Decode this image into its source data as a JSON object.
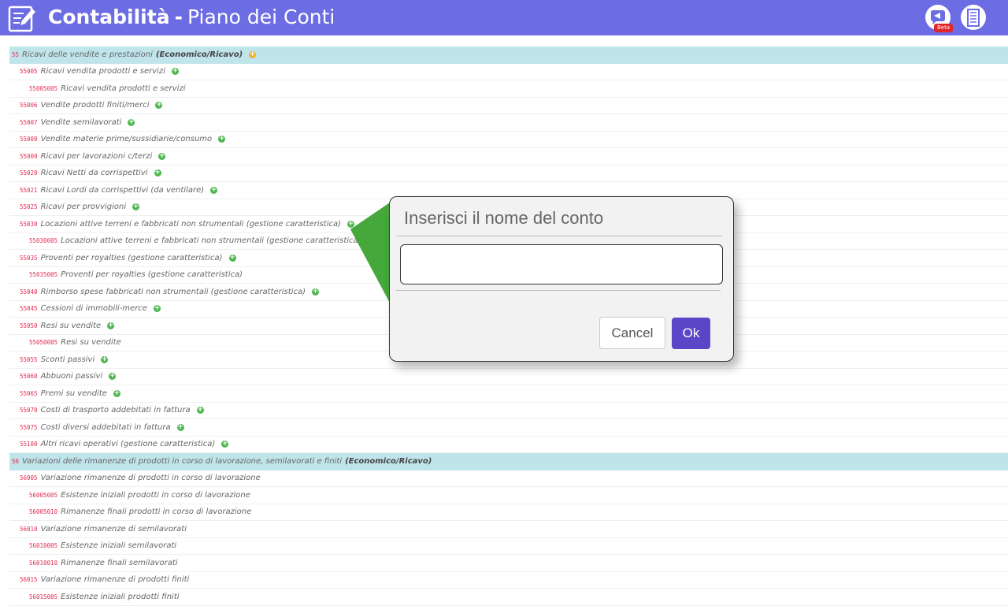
{
  "header": {
    "title": "Contabilità",
    "separator": "-",
    "subtitle": "Piano dei Conti",
    "beta_badge": "Beta"
  },
  "accounts": [
    {
      "level": 0,
      "code": "55",
      "name": "Ricavi delle vendite e prestazioni",
      "tag": "(Economico/Ricavo)",
      "add": true
    },
    {
      "level": 1,
      "code": "55005",
      "name": "Ricavi vendita prodotti e servizi",
      "add": true
    },
    {
      "level": 2,
      "code": "55005005",
      "name": "Ricavi vendita prodotti e servizi",
      "add": false
    },
    {
      "level": 1,
      "code": "55006",
      "name": "Vendite prodotti finiti/merci",
      "add": true
    },
    {
      "level": 1,
      "code": "55007",
      "name": "Vendite semilavorati",
      "add": true
    },
    {
      "level": 1,
      "code": "55008",
      "name": "Vendite materie prime/sussidiarie/consumo",
      "add": true
    },
    {
      "level": 1,
      "code": "55009",
      "name": "Ricavi per lavorazioni c/terzi",
      "add": true
    },
    {
      "level": 1,
      "code": "55020",
      "name": "Ricavi Netti da corrispettivi",
      "add": true
    },
    {
      "level": 1,
      "code": "55021",
      "name": "Ricavi Lordi da corrispettivi (da ventilare)",
      "add": true
    },
    {
      "level": 1,
      "code": "55025",
      "name": "Ricavi per provvigioni",
      "add": true
    },
    {
      "level": 1,
      "code": "55030",
      "name": "Locazioni attive terreni e fabbricati non strumentali (gestione caratteristica)",
      "add": true
    },
    {
      "level": 2,
      "code": "55030005",
      "name": "Locazioni attive terreni e fabbricati non strumentali (gestione caratteristica)",
      "add": false
    },
    {
      "level": 1,
      "code": "55035",
      "name": "Proventi per royalties (gestione caratteristica)",
      "add": true
    },
    {
      "level": 2,
      "code": "55035005",
      "name": "Proventi per royalties (gestione caratteristica)",
      "add": false
    },
    {
      "level": 1,
      "code": "55040",
      "name": "Rimborso spese fabbricati non strumentali (gestione caratteristica)",
      "add": true
    },
    {
      "level": 1,
      "code": "55045",
      "name": "Cessioni di immobili-merce",
      "add": true
    },
    {
      "level": 1,
      "code": "55050",
      "name": "Resi su vendite",
      "add": true
    },
    {
      "level": 2,
      "code": "55050005",
      "name": "Resi su vendite",
      "add": false
    },
    {
      "level": 1,
      "code": "55055",
      "name": "Sconti passivi",
      "add": true
    },
    {
      "level": 1,
      "code": "55060",
      "name": "Abbuoni passivi",
      "add": true
    },
    {
      "level": 1,
      "code": "55065",
      "name": "Premi su vendite",
      "add": true
    },
    {
      "level": 1,
      "code": "55070",
      "name": "Costi di trasporto addebitati in fattura",
      "add": true
    },
    {
      "level": 1,
      "code": "55075",
      "name": "Costi diversi addebitati in fattura",
      "add": true
    },
    {
      "level": 1,
      "code": "55100",
      "name": "Altri ricavi operativi (gestione caratteristica)",
      "add": true
    },
    {
      "level": 0,
      "code": "56",
      "name": "Variazioni delle rimanenze di prodotti in corso di lavorazione, semilavorati e finiti",
      "tag": "(Economico/Ricavo)",
      "add": false
    },
    {
      "level": 1,
      "code": "56005",
      "name": "Variazione rimanenze di prodotti in corso di lavorazione",
      "add": false
    },
    {
      "level": 2,
      "code": "56005005",
      "name": "Esistenze iniziali prodotti in corso di lavorazione",
      "add": false
    },
    {
      "level": 2,
      "code": "56005010",
      "name": "Rimanenze finali prodotti in corso di lavorazione",
      "add": false
    },
    {
      "level": 1,
      "code": "56010",
      "name": "Variazione rimanenze di semilavorati",
      "add": false
    },
    {
      "level": 2,
      "code": "56010005",
      "name": "Esistenze iniziali semilavorati",
      "add": false
    },
    {
      "level": 2,
      "code": "56010010",
      "name": "Rimanenze finali semilavorati",
      "add": false
    },
    {
      "level": 1,
      "code": "56015",
      "name": "Variazione rimanenze di prodotti finiti",
      "add": false
    },
    {
      "level": 2,
      "code": "56015005",
      "name": "Esistenze iniziali prodotti finiti",
      "add": false
    }
  ],
  "dialog": {
    "title": "Inserisci il nome del conto",
    "input_value": "",
    "cancel_label": "Cancel",
    "ok_label": "Ok"
  },
  "colors": {
    "header_bg": "#6c6ce3",
    "group_row_bg": "#bfe4ea",
    "code_color": "#e02e55",
    "add_icon": "#4cb64f",
    "group_add_icon": "#f0b030",
    "pointer": "#46a83a",
    "ok_button": "#5b46c7",
    "beta_badge": "#e0262b"
  }
}
